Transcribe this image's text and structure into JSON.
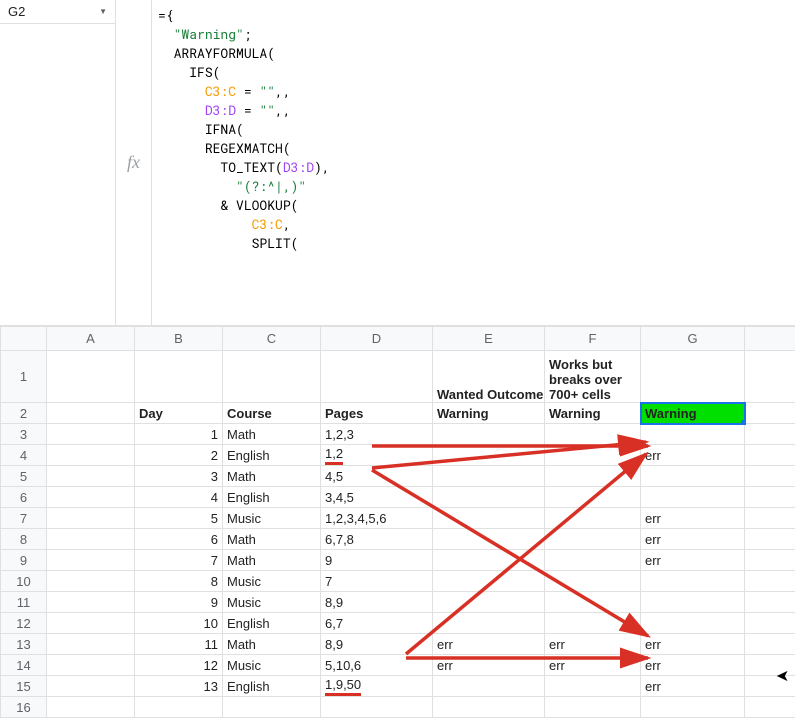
{
  "namebox": {
    "cell": "G2"
  },
  "fx_label": "fx",
  "formula": {
    "tokens": [
      {
        "t": "=",
        "c": "tok-eq"
      },
      {
        "t": "{",
        "c": "tok-punc"
      },
      {
        "t": "\n"
      },
      {
        "t": "  ",
        "c": null
      },
      {
        "t": "\"Warning\"",
        "c": "tok-str"
      },
      {
        "t": ";",
        "c": "tok-punc"
      },
      {
        "t": "\n"
      },
      {
        "t": "  ",
        "c": null
      },
      {
        "t": "ARRAYFORMULA",
        "c": "tok-fn"
      },
      {
        "t": "(",
        "c": "tok-punc"
      },
      {
        "t": "\n"
      },
      {
        "t": "    ",
        "c": null
      },
      {
        "t": "IFS",
        "c": "tok-fn"
      },
      {
        "t": "(",
        "c": "tok-punc"
      },
      {
        "t": "\n"
      },
      {
        "t": "      ",
        "c": null
      },
      {
        "t": "C3:C",
        "c": "tok-rng1"
      },
      {
        "t": " = ",
        "c": "tok-punc"
      },
      {
        "t": "\"\"",
        "c": "tok-str"
      },
      {
        "t": ",,",
        "c": "tok-punc"
      },
      {
        "t": "\n"
      },
      {
        "t": "      ",
        "c": null
      },
      {
        "t": "D3:D",
        "c": "tok-rng2"
      },
      {
        "t": " = ",
        "c": "tok-punc"
      },
      {
        "t": "\"\"",
        "c": "tok-str"
      },
      {
        "t": ",,",
        "c": "tok-punc"
      },
      {
        "t": "\n"
      },
      {
        "t": "      ",
        "c": null
      },
      {
        "t": "IFNA",
        "c": "tok-fn"
      },
      {
        "t": "(",
        "c": "tok-punc"
      },
      {
        "t": "\n"
      },
      {
        "t": "      ",
        "c": null
      },
      {
        "t": "REGEXMATCH",
        "c": "tok-fn"
      },
      {
        "t": "(",
        "c": "tok-punc"
      },
      {
        "t": "\n"
      },
      {
        "t": "        ",
        "c": null
      },
      {
        "t": "TO_TEXT",
        "c": "tok-fn"
      },
      {
        "t": "(",
        "c": "tok-punc"
      },
      {
        "t": "D3:D",
        "c": "tok-rng2"
      },
      {
        "t": "),",
        "c": "tok-punc"
      },
      {
        "t": "\n"
      },
      {
        "t": "          ",
        "c": null
      },
      {
        "t": "\"(?:^|,)\"",
        "c": "tok-str"
      },
      {
        "t": "\n"
      },
      {
        "t": "        & ",
        "c": "tok-punc"
      },
      {
        "t": "VLOOKUP",
        "c": "tok-fn"
      },
      {
        "t": "(",
        "c": "tok-punc"
      },
      {
        "t": "\n"
      },
      {
        "t": "            ",
        "c": null
      },
      {
        "t": "C3:C",
        "c": "tok-rng1"
      },
      {
        "t": ",",
        "c": "tok-punc"
      },
      {
        "t": "\n"
      },
      {
        "t": "            ",
        "c": null
      },
      {
        "t": "SPLIT",
        "c": "tok-fn"
      },
      {
        "t": "(",
        "c": "tok-punc"
      }
    ]
  },
  "columns": [
    "A",
    "B",
    "C",
    "D",
    "E",
    "F",
    "G"
  ],
  "header_row1": {
    "E": "Wanted Outcome",
    "F": "Works but breaks over 700+ cells"
  },
  "header_row2": {
    "B": "Day",
    "C": "Course",
    "D": "Pages",
    "E": "Warning",
    "F": "Warning",
    "G": "Warning"
  },
  "rows": [
    {
      "n": "3",
      "B": "1",
      "C": "Math",
      "D": "1,2,3",
      "E": "",
      "F": "",
      "G": ""
    },
    {
      "n": "4",
      "B": "2",
      "C": "English",
      "D": "1,2",
      "E": "",
      "F": "",
      "G": "err",
      "D_under": true
    },
    {
      "n": "5",
      "B": "3",
      "C": "Math",
      "D": "4,5",
      "E": "",
      "F": "",
      "G": ""
    },
    {
      "n": "6",
      "B": "4",
      "C": "English",
      "D": "3,4,5",
      "E": "",
      "F": "",
      "G": ""
    },
    {
      "n": "7",
      "B": "5",
      "C": "Music",
      "D": "1,2,3,4,5,6",
      "E": "",
      "F": "",
      "G": "err"
    },
    {
      "n": "8",
      "B": "6",
      "C": "Math",
      "D": "6,7,8",
      "E": "",
      "F": "",
      "G": "err"
    },
    {
      "n": "9",
      "B": "7",
      "C": "Math",
      "D": "9",
      "E": "",
      "F": "",
      "G": "err"
    },
    {
      "n": "10",
      "B": "8",
      "C": "Music",
      "D": "7",
      "E": "",
      "F": "",
      "G": ""
    },
    {
      "n": "11",
      "B": "9",
      "C": "Music",
      "D": "8,9",
      "E": "",
      "F": "",
      "G": ""
    },
    {
      "n": "12",
      "B": "10",
      "C": "English",
      "D": "6,7",
      "E": "",
      "F": "",
      "G": ""
    },
    {
      "n": "13",
      "B": "11",
      "C": "Math",
      "D": "8,9",
      "E": "err",
      "F": "err",
      "G": "err"
    },
    {
      "n": "14",
      "B": "12",
      "C": "Music",
      "D": "5,10,6",
      "E": "err",
      "F": "err",
      "G": "err"
    },
    {
      "n": "15",
      "B": "13",
      "C": "English",
      "D": "1,9,50",
      "E": "",
      "F": "",
      "G": "err",
      "D_under": true
    },
    {
      "n": "16",
      "B": "",
      "C": "",
      "D": "",
      "E": "",
      "F": "",
      "G": ""
    }
  ]
}
